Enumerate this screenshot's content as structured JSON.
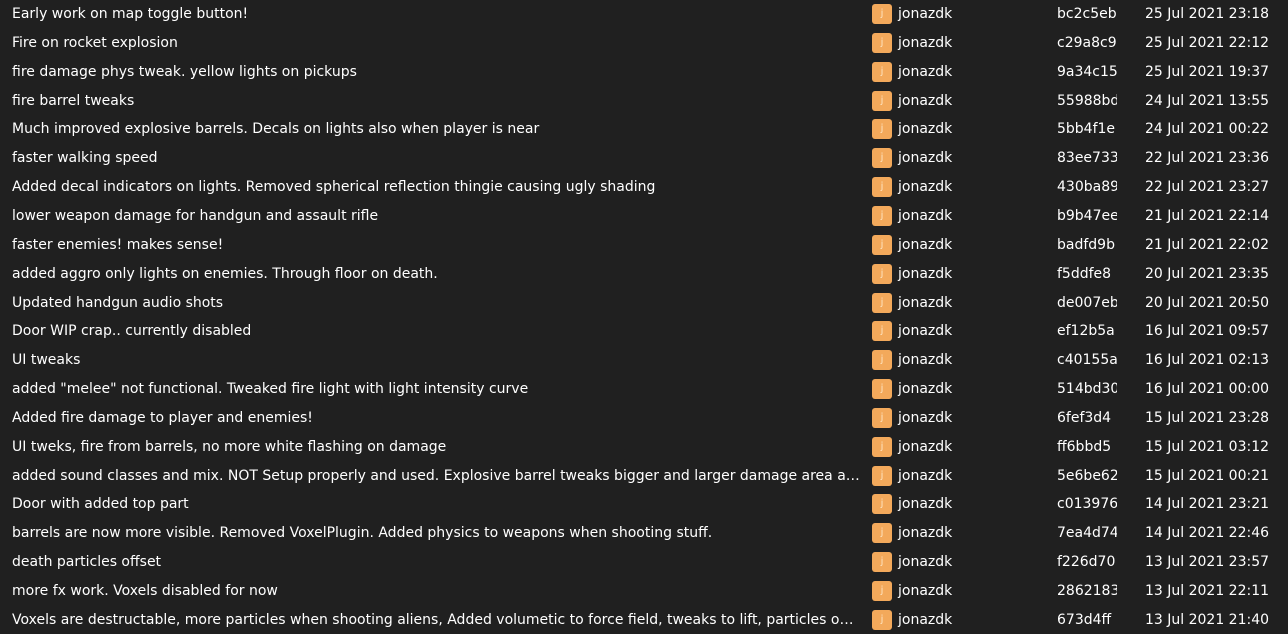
{
  "theme": {
    "background": "#202020",
    "text": "#ffffff",
    "avatar_color": "#f3a95b"
  },
  "icons": {
    "avatar": "user-avatar-icon"
  },
  "commits": [
    {
      "message": "Early work on map toggle button!",
      "avatar_letter": "j",
      "author": "jonazdk",
      "hash": "bc2c5eb",
      "date": "25 Jul 2021 23:18"
    },
    {
      "message": "Fire on rocket explosion",
      "avatar_letter": "j",
      "author": "jonazdk",
      "hash": "c29a8c9",
      "date": "25 Jul 2021 22:12"
    },
    {
      "message": "fire damage phys tweak. yellow lights on pickups",
      "avatar_letter": "j",
      "author": "jonazdk",
      "hash": "9a34c15",
      "date": "25 Jul 2021 19:37"
    },
    {
      "message": "fire barrel tweaks",
      "avatar_letter": "j",
      "author": "jonazdk",
      "hash": "55988bd",
      "date": "24 Jul 2021 13:55"
    },
    {
      "message": "Much improved explosive barrels. Decals on lights also when player is near",
      "avatar_letter": "j",
      "author": "jonazdk",
      "hash": "5bb4f1e",
      "date": "24 Jul 2021 00:22"
    },
    {
      "message": "faster walking speed",
      "avatar_letter": "j",
      "author": "jonazdk",
      "hash": "83ee733",
      "date": "22 Jul 2021 23:36"
    },
    {
      "message": "Added decal indicators on lights. Removed spherical reflection thingie causing ugly shading",
      "avatar_letter": "j",
      "author": "jonazdk",
      "hash": "430ba89",
      "date": "22 Jul 2021 23:27"
    },
    {
      "message": "lower weapon damage for handgun and assault rifle",
      "avatar_letter": "j",
      "author": "jonazdk",
      "hash": "b9b47ee",
      "date": "21 Jul 2021 22:14"
    },
    {
      "message": "faster enemies! makes sense!",
      "avatar_letter": "j",
      "author": "jonazdk",
      "hash": "badfd9b",
      "date": "21 Jul 2021 22:02"
    },
    {
      "message": "added aggro only lights on enemies. Through floor on death.",
      "avatar_letter": "j",
      "author": "jonazdk",
      "hash": "f5ddfe8",
      "date": "20 Jul 2021 23:35"
    },
    {
      "message": "Updated handgun audio shots",
      "avatar_letter": "j",
      "author": "jonazdk",
      "hash": "de007eb",
      "date": "20 Jul 2021 20:50"
    },
    {
      "message": "Door WIP crap.. currently disabled",
      "avatar_letter": "j",
      "author": "jonazdk",
      "hash": "ef12b5a",
      "date": "16 Jul 2021 09:57"
    },
    {
      "message": "UI tweaks",
      "avatar_letter": "j",
      "author": "jonazdk",
      "hash": "c40155a",
      "date": "16 Jul 2021 02:13"
    },
    {
      "message": "added \"melee\" not functional. Tweaked fire light with light intensity curve",
      "avatar_letter": "j",
      "author": "jonazdk",
      "hash": "514bd30",
      "date": "16 Jul 2021 00:00"
    },
    {
      "message": "Added fire damage to player and enemies!",
      "avatar_letter": "j",
      "author": "jonazdk",
      "hash": "6fef3d4",
      "date": "15 Jul 2021 23:28"
    },
    {
      "message": "UI tweks, fire from barrels, no more white flashing on damage",
      "avatar_letter": "j",
      "author": "jonazdk",
      "hash": "ff6bbd5",
      "date": "15 Jul 2021 03:12"
    },
    {
      "message": "added sound classes and mix. NOT Setup properly and used. Explosive barrel tweaks bigger and larger damage area and some...",
      "avatar_letter": "j",
      "author": "jonazdk",
      "hash": "5e6be62",
      "date": "15 Jul 2021 00:21"
    },
    {
      "message": "Door with added top part",
      "avatar_letter": "j",
      "author": "jonazdk",
      "hash": "c013976",
      "date": "14 Jul 2021 23:21"
    },
    {
      "message": "barrels are now more visible. Removed VoxelPlugin. Added physics to weapons when shooting stuff.",
      "avatar_letter": "j",
      "author": "jonazdk",
      "hash": "7ea4d74",
      "date": "14 Jul 2021 22:46"
    },
    {
      "message": "death particles offset",
      "avatar_letter": "j",
      "author": "jonazdk",
      "hash": "f226d70",
      "date": "13 Jul 2021 23:57"
    },
    {
      "message": "more fx work. Voxels disabled for now",
      "avatar_letter": "j",
      "author": "jonazdk",
      "hash": "2862183",
      "date": "13 Jul 2021 22:11"
    },
    {
      "message": "Voxels are destructable, more particles when shooting aliens, Added volumetic to force field, tweaks to lift, particles on \"acid d...",
      "avatar_letter": "j",
      "author": "jonazdk",
      "hash": "673d4ff",
      "date": "13 Jul 2021 21:40"
    }
  ]
}
